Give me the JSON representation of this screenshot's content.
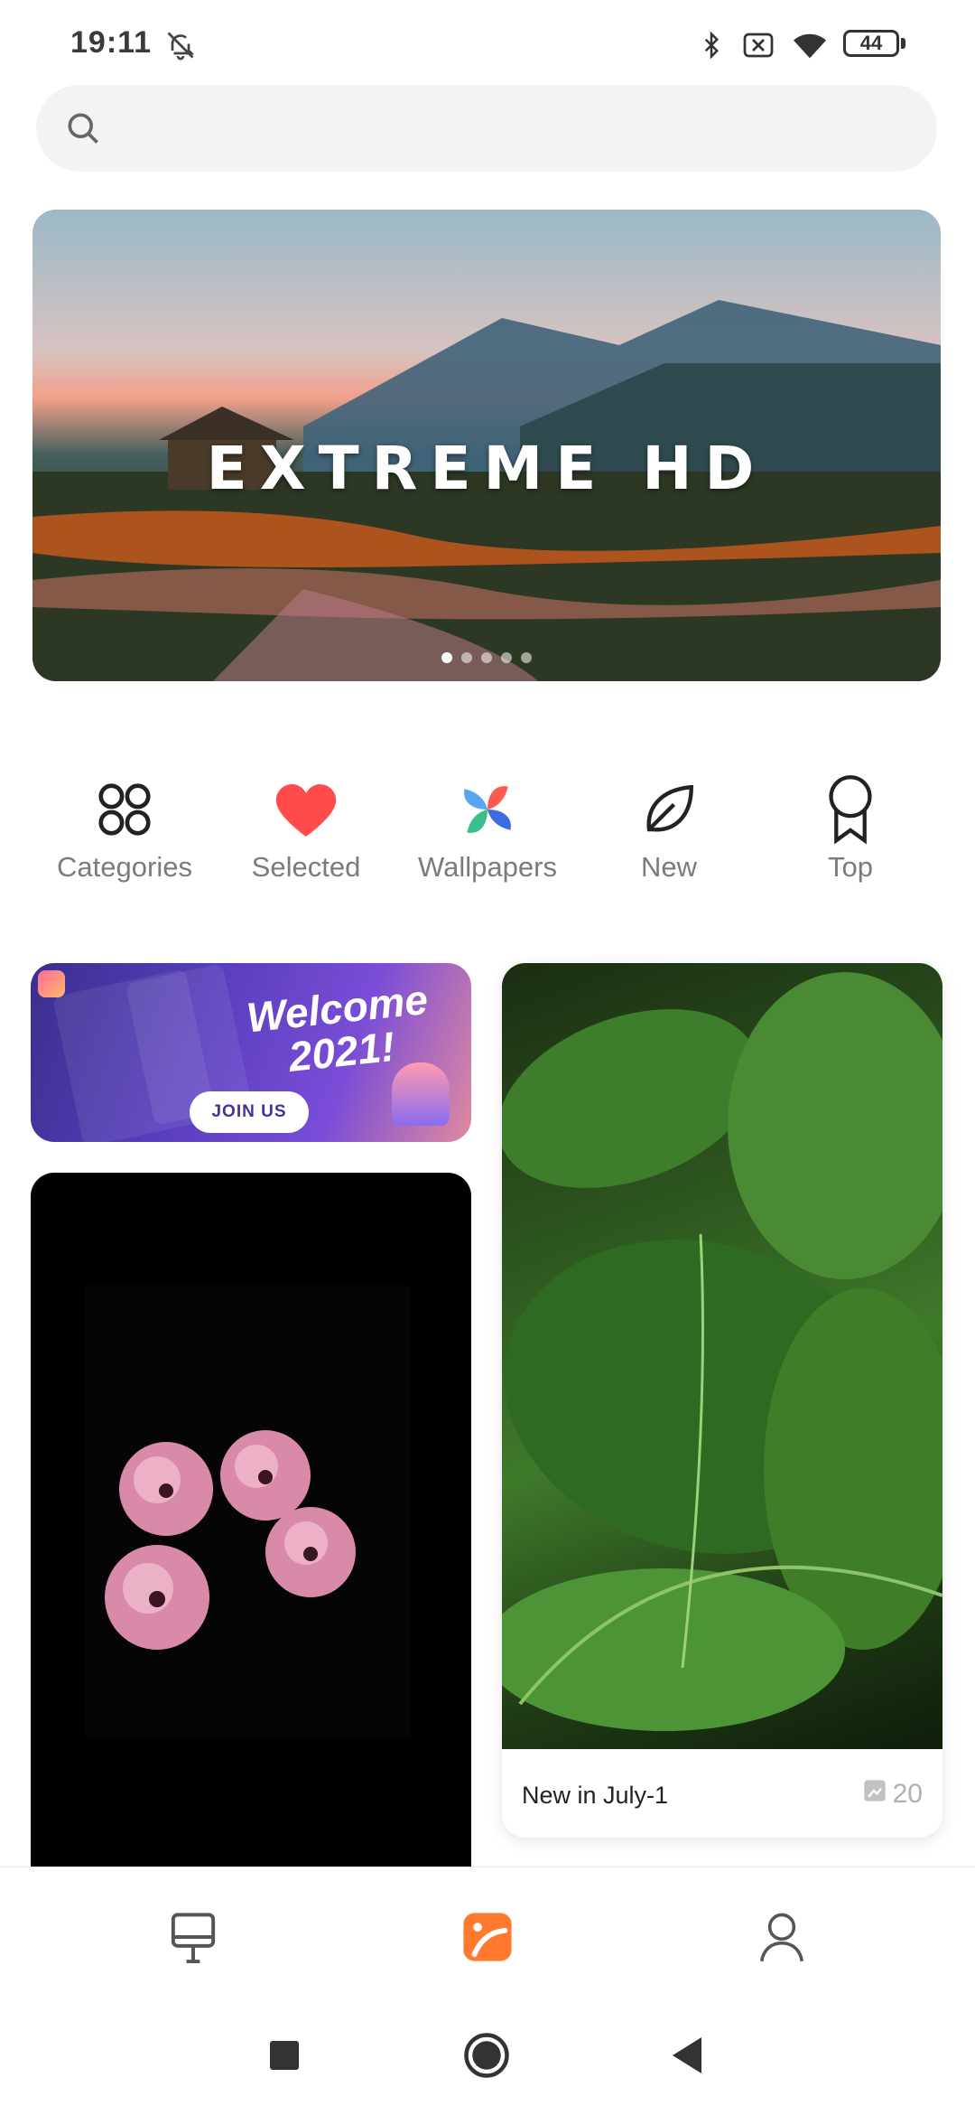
{
  "status": {
    "time": "19:11",
    "battery": "44",
    "icons": [
      "mute-bell-icon",
      "bluetooth-icon",
      "no-sim-icon",
      "wifi-icon",
      "battery-icon"
    ]
  },
  "search": {
    "placeholder": "",
    "icon": "search-icon"
  },
  "banner": {
    "title": "EXTREME HD",
    "slides": 5,
    "active_slide": 1
  },
  "quick_nav": [
    {
      "label": "Categories",
      "icon": "categories-icon"
    },
    {
      "label": "Selected",
      "icon": "heart-icon"
    },
    {
      "label": "Wallpapers",
      "icon": "pinwheel-icon"
    },
    {
      "label": "New",
      "icon": "leaf-icon"
    },
    {
      "label": "Top",
      "icon": "ribbon-icon"
    }
  ],
  "promo": {
    "title_line1": "Welcome",
    "title_line2": "2021!",
    "button": "JOIN US"
  },
  "cards": {
    "plant": {
      "caption": "New in July-1",
      "count": "20"
    }
  },
  "bottom_tabs": [
    {
      "icon": "easel-icon",
      "active": false
    },
    {
      "icon": "themes-icon",
      "active": true
    },
    {
      "icon": "profile-icon",
      "active": false
    }
  ],
  "colors": {
    "accent": "#ff7a2f",
    "heart": "#ff4b4b",
    "label": "#7b7b7b"
  }
}
